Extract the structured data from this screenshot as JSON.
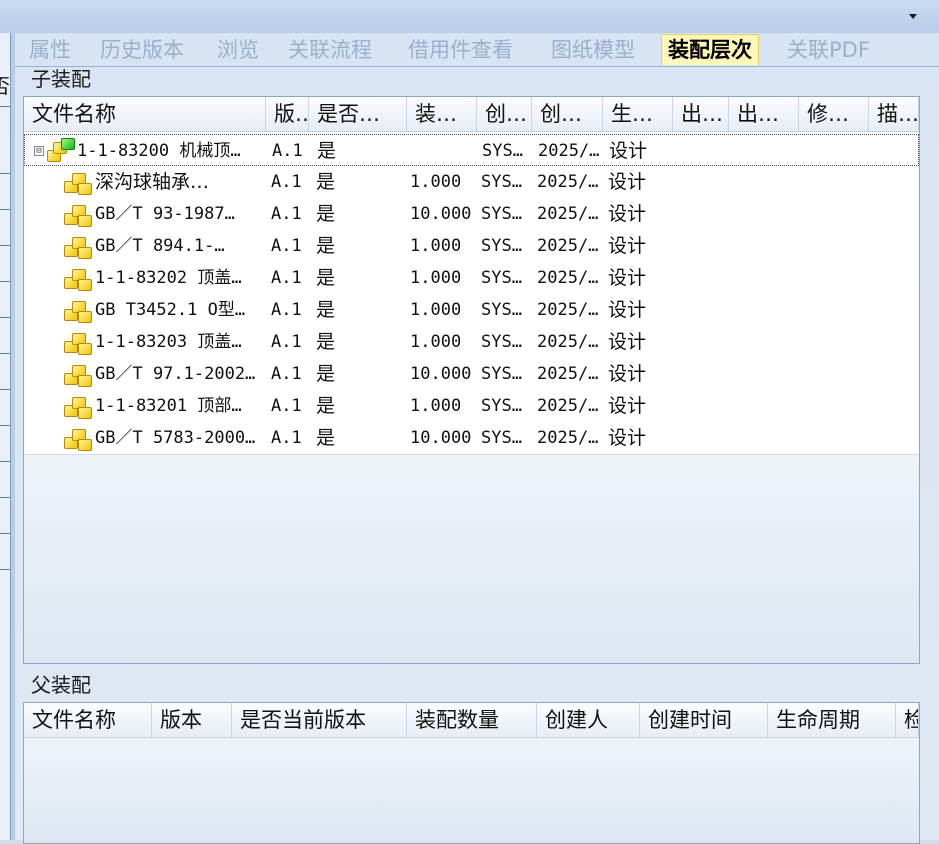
{
  "tabs": [
    {
      "label": "属性",
      "active": false
    },
    {
      "label": "历史版本",
      "active": false
    },
    {
      "label": "浏览",
      "active": false
    },
    {
      "label": "关联流程",
      "active": false
    },
    {
      "label": "借用件查看",
      "active": false
    },
    {
      "label": "图纸模型",
      "active": false
    },
    {
      "label": "装配层次",
      "active": true
    },
    {
      "label": "关联PDF",
      "active": false
    }
  ],
  "left_panel": {
    "partial_header_text": "否"
  },
  "child_assembly": {
    "title": "子装配",
    "columns": [
      "文件名称",
      "版…",
      "是否…",
      "装…",
      "创…",
      "创…",
      "生…",
      "出…",
      "出…",
      "修…",
      "描…"
    ],
    "rows": [
      {
        "name": "1-1-83200 机械顶…",
        "version": "A.1",
        "current": "是",
        "qty": "",
        "creator": "SYS…",
        "created": "2025/…",
        "lifecycle": "设计",
        "icon": "assembly-icon"
      },
      {
        "name": "深沟球轴承…",
        "version": "A.1",
        "current": "是",
        "qty": "1.000",
        "creator": "SYS…",
        "created": "2025/…",
        "lifecycle": "设计",
        "icon": "part-icon"
      },
      {
        "name": "GB／T 93-1987…",
        "version": "A.1",
        "current": "是",
        "qty": "10.000",
        "creator": "SYS…",
        "created": "2025/…",
        "lifecycle": "设计",
        "icon": "part-icon"
      },
      {
        "name": "GB／T 894.1-…",
        "version": "A.1",
        "current": "是",
        "qty": "1.000",
        "creator": "SYS…",
        "created": "2025/…",
        "lifecycle": "设计",
        "icon": "part-icon"
      },
      {
        "name": "1-1-83202 顶盖…",
        "version": "A.1",
        "current": "是",
        "qty": "1.000",
        "creator": "SYS…",
        "created": "2025/…",
        "lifecycle": "设计",
        "icon": "part-icon"
      },
      {
        "name": "GB T3452.1 O型…",
        "version": "A.1",
        "current": "是",
        "qty": "1.000",
        "creator": "SYS…",
        "created": "2025/…",
        "lifecycle": "设计",
        "icon": "part-icon"
      },
      {
        "name": "1-1-83203 顶盖…",
        "version": "A.1",
        "current": "是",
        "qty": "1.000",
        "creator": "SYS…",
        "created": "2025/…",
        "lifecycle": "设计",
        "icon": "part-icon"
      },
      {
        "name": "GB／T 97.1-2002…",
        "version": "A.1",
        "current": "是",
        "qty": "10.000",
        "creator": "SYS…",
        "created": "2025/…",
        "lifecycle": "设计",
        "icon": "part-icon"
      },
      {
        "name": "1-1-83201 顶部…",
        "version": "A.1",
        "current": "是",
        "qty": "1.000",
        "creator": "SYS…",
        "created": "2025/…",
        "lifecycle": "设计",
        "icon": "part-icon"
      },
      {
        "name": "GB／T 5783-2000…",
        "version": "A.1",
        "current": "是",
        "qty": "10.000",
        "creator": "SYS…",
        "created": "2025/…",
        "lifecycle": "设计",
        "icon": "part-icon"
      }
    ]
  },
  "parent_assembly": {
    "title": "父装配",
    "columns": [
      "文件名称",
      "版本",
      "是否当前版本",
      "装配数量",
      "创建人",
      "创建时间",
      "生命周期",
      "检"
    ]
  },
  "colors": {
    "active_tab": "#fff7b8",
    "inactive_tab_text": "#9ab0cc",
    "grid_border": "#8ea6c4"
  }
}
